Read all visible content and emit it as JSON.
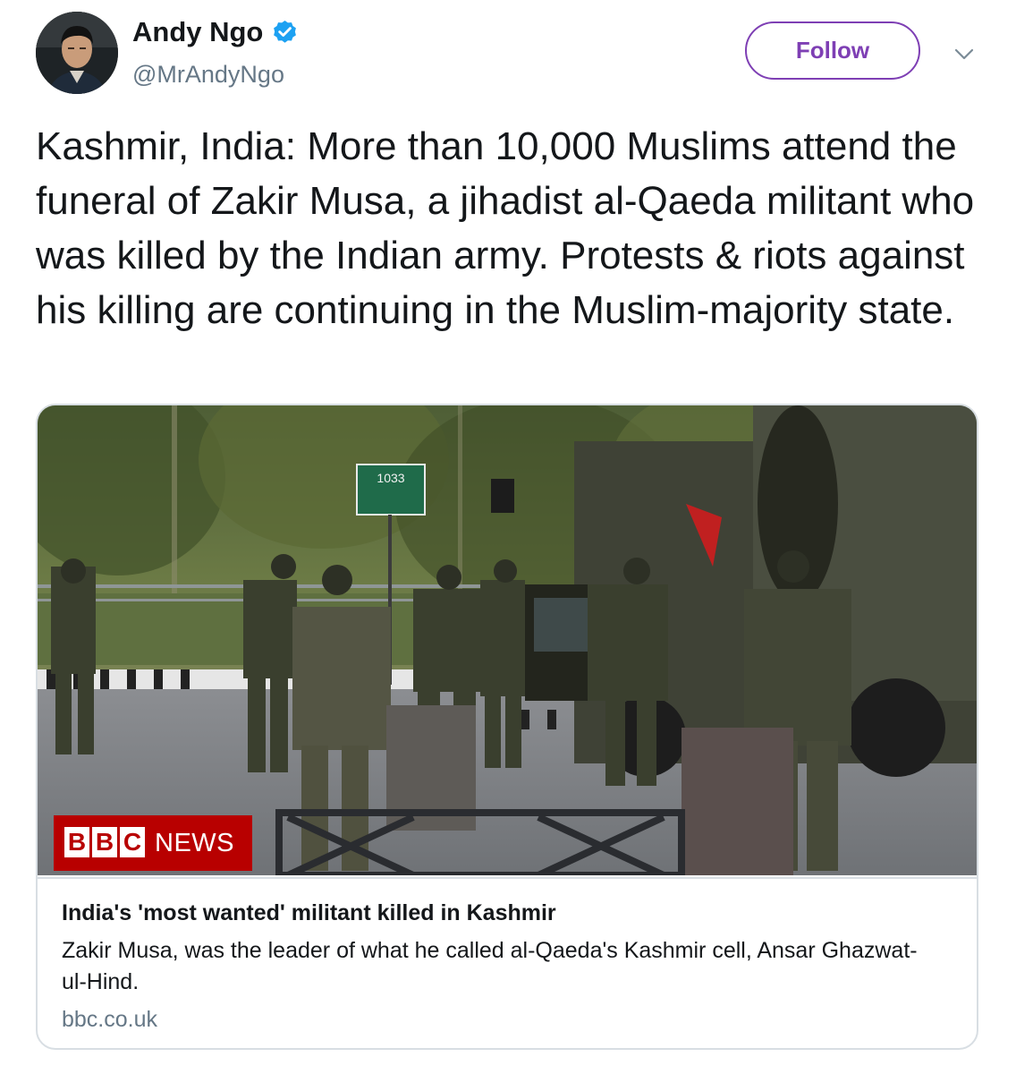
{
  "author": {
    "name": "Andy Ngo",
    "handle": "@MrAndyNgo",
    "verified": true,
    "avatar_icon": "profile-photo"
  },
  "actions": {
    "follow_label": "Follow",
    "menu_icon": "chevron-down-icon"
  },
  "tweet": {
    "text": "Kashmir, India: More than 10,000 Muslims attend the funeral of Zakir Musa, a jihadist al-Qaeda militant who was killed by the Indian army. Protests & riots against his killing are continuing in the Muslim-majority state."
  },
  "card": {
    "image_description_icon": "news-photo",
    "brand": {
      "letters": [
        "B",
        "B",
        "C"
      ],
      "suffix": "NEWS",
      "color": "#b80000"
    },
    "sign_number": "1033",
    "title": "India's 'most wanted' militant killed in Kashmir",
    "description": "Zakir Musa, was the leader of what he called al-Qaeda's Kashmir cell, Ansar Ghazwat-ul-Hind.",
    "domain": "bbc.co.uk"
  },
  "colors": {
    "follow_accent": "#7e3fb4",
    "verified_badge": "#1da1f2",
    "secondary_text": "#657786",
    "border": "#d8dee3"
  }
}
